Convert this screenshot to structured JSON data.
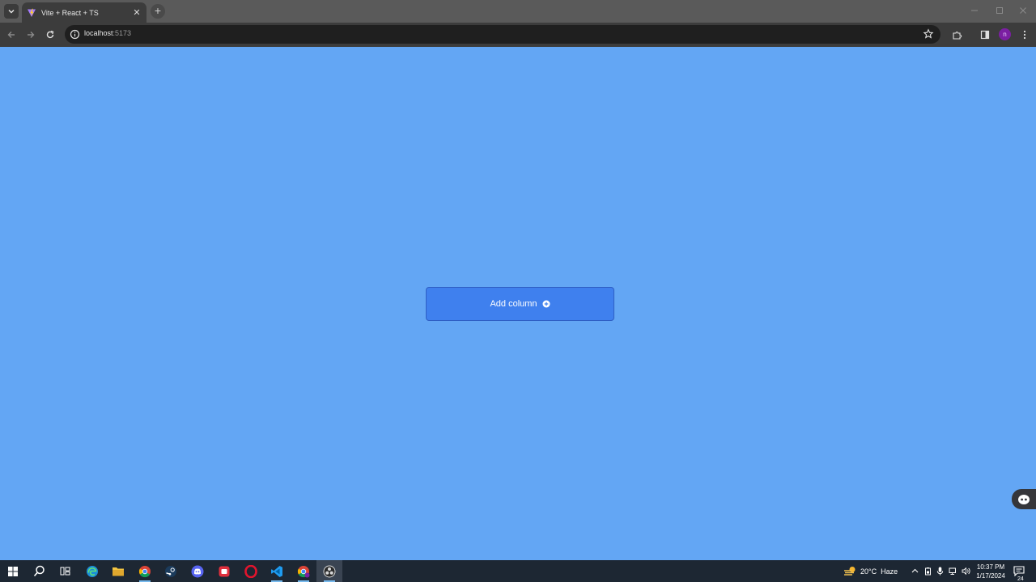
{
  "browser": {
    "tab": {
      "title": "Vite + React + TS"
    },
    "new_tab_symbol": "+",
    "url_host": "localhost",
    "url_port": ":5173",
    "profile_initial": "n"
  },
  "page": {
    "background_color": "#63a6f4",
    "add_column_button": {
      "label": "Add column",
      "icon": "plus-circle-icon",
      "color": "#3f80ee"
    }
  },
  "taskbar": {
    "apps": [
      "start",
      "search",
      "task-view",
      "edge",
      "file-explorer",
      "chrome",
      "steam",
      "discord",
      "app-red",
      "opera",
      "vscode",
      "chrome-profile",
      "obs"
    ],
    "weather": {
      "temp": "20°C",
      "condition": "Haze"
    },
    "clock": {
      "time": "10:37 PM",
      "date": "1/17/2024"
    },
    "notification_count": "24"
  }
}
